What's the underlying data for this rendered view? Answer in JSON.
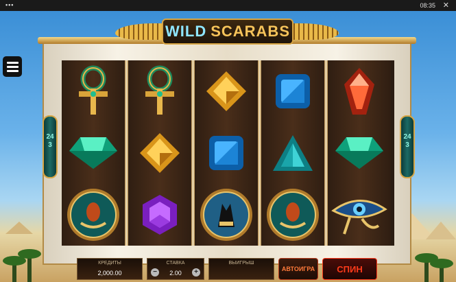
{
  "topbar": {
    "dots": "•••",
    "clock": "08:35",
    "close": "✕"
  },
  "menu": {
    "icon": "hamburger-menu-icon"
  },
  "logo": {
    "word1": "WILD",
    "word2": "SCARABS"
  },
  "ways": {
    "left": "243",
    "right": "243"
  },
  "reels": [
    {
      "symbols": [
        {
          "name": "ankh-icon"
        },
        {
          "name": "gem-green-icon"
        },
        {
          "name": "scarab-coin-icon"
        }
      ]
    },
    {
      "symbols": [
        {
          "name": "ankh-icon"
        },
        {
          "name": "gem-yellow-icon"
        },
        {
          "name": "gem-purple-icon"
        }
      ]
    },
    {
      "symbols": [
        {
          "name": "gem-yellow-icon"
        },
        {
          "name": "gem-blue-icon"
        },
        {
          "name": "anubis-coin-icon"
        }
      ]
    },
    {
      "symbols": [
        {
          "name": "gem-blue-icon"
        },
        {
          "name": "gem-teal-triangle-icon"
        },
        {
          "name": "scarab-coin-icon"
        }
      ]
    },
    {
      "symbols": [
        {
          "name": "gem-red-icon"
        },
        {
          "name": "gem-green-icon"
        },
        {
          "name": "eye-of-horus-icon"
        }
      ]
    }
  ],
  "controls": {
    "credits_label": "КРЕДИТЫ",
    "credits_value": "2,000.00",
    "bet_label": "СТАВКА",
    "bet_value": "2.00",
    "minus": "−",
    "plus": "+",
    "win_label": "ВЫИГРЫШ",
    "win_value": "",
    "autoplay_label": "АВТОИГРА",
    "spin_label": "СПИН"
  },
  "colors": {
    "spin": "#c21a12",
    "autoplay": "#8a1a12",
    "frame_gold": "#d7a544"
  }
}
